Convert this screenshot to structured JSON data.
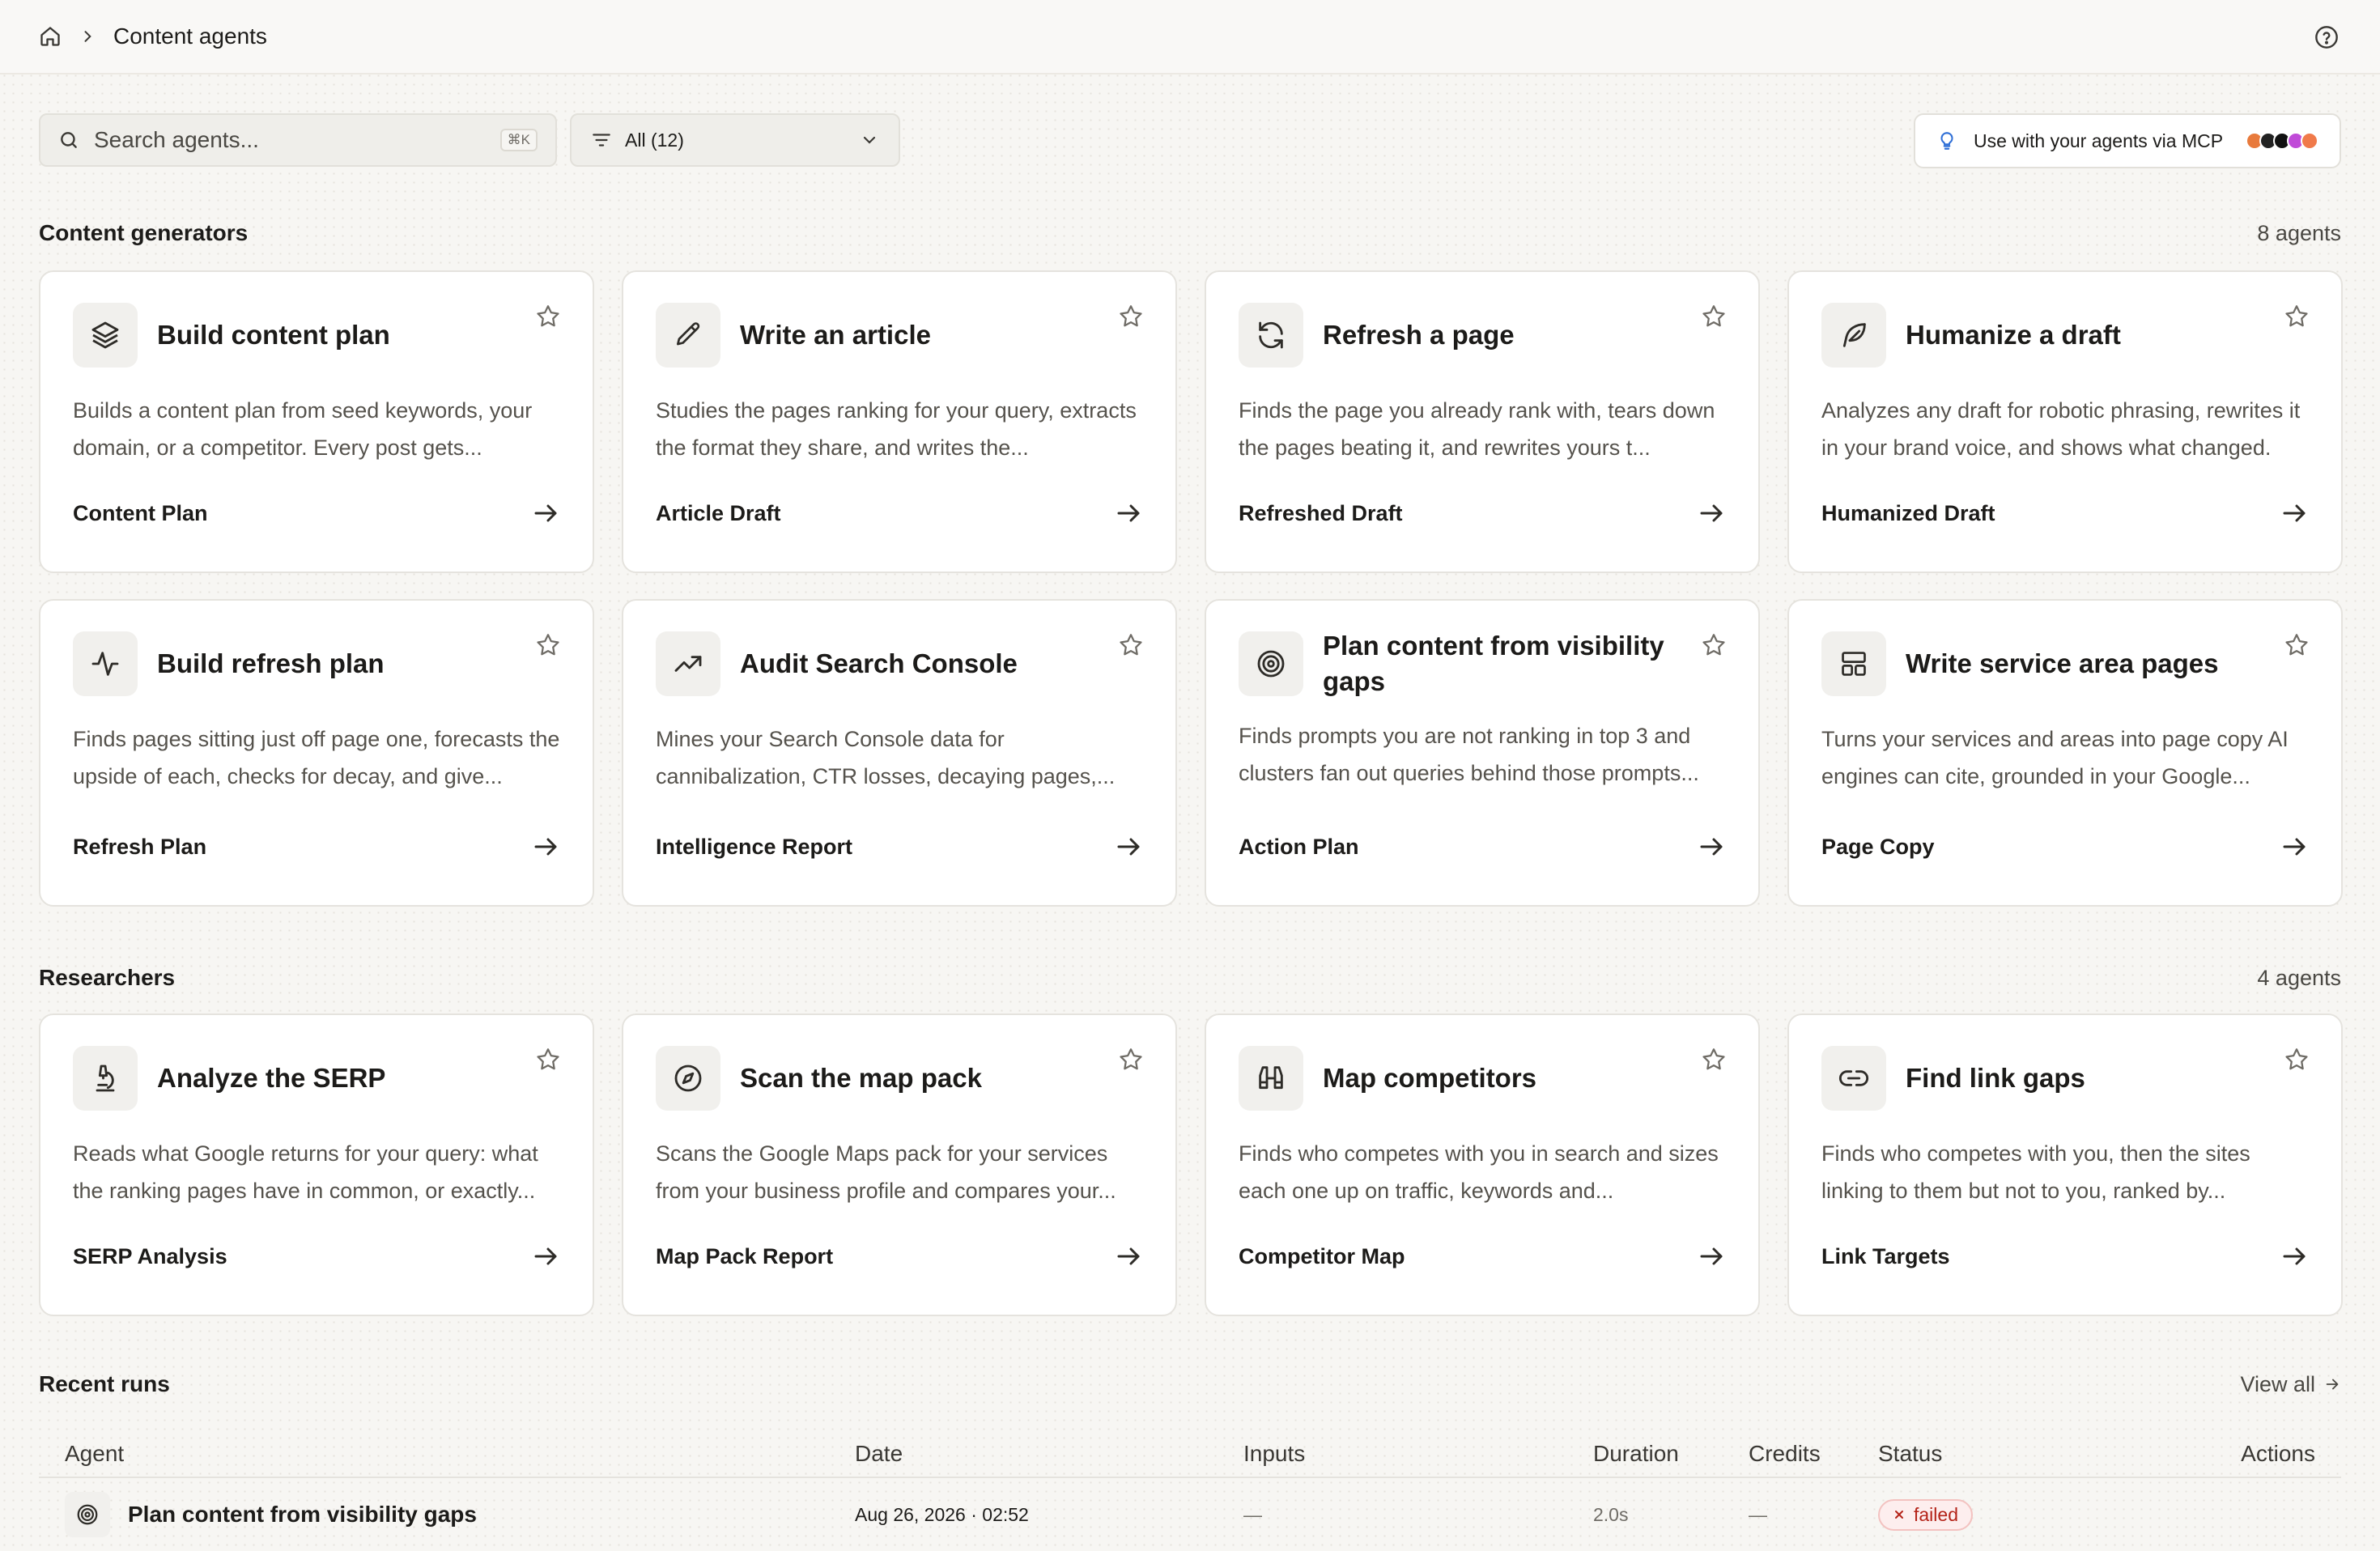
{
  "breadcrumb": {
    "current": "Content agents"
  },
  "search": {
    "placeholder": "Search agents...",
    "shortcut": "⌘K"
  },
  "filter": {
    "label": "All (12)"
  },
  "mcp": {
    "label": "Use with your agents via MCP",
    "logo_colors": [
      "#e87a3c",
      "#222222",
      "#111111",
      "#c04bd8",
      "#f07a4a"
    ]
  },
  "sections": [
    {
      "title": "Content generators",
      "count": "8 agents",
      "cards": [
        {
          "title": "Build content plan",
          "icon": "layers-icon",
          "desc": "Builds a content plan from seed keywords, your domain, or a competitor. Every post gets...",
          "output": "Content Plan"
        },
        {
          "title": "Write an article",
          "icon": "pencil-icon",
          "desc": "Studies the pages ranking for your query, extracts the format they share, and writes the...",
          "output": "Article Draft"
        },
        {
          "title": "Refresh a page",
          "icon": "refresh-icon",
          "desc": "Finds the page you already rank with, tears down the pages beating it, and rewrites yours t...",
          "output": "Refreshed Draft"
        },
        {
          "title": "Humanize a draft",
          "icon": "feather-icon",
          "desc": "Analyzes any draft for robotic phrasing, rewrites it in your brand voice, and shows what changed.",
          "output": "Humanized Draft"
        },
        {
          "title": "Build refresh plan",
          "icon": "activity-icon",
          "desc": "Finds pages sitting just off page one, forecasts the upside of each, checks for decay, and give...",
          "output": "Refresh Plan"
        },
        {
          "title": "Audit Search Console",
          "icon": "trending-up-icon",
          "desc": "Mines your Search Console data for cannibalization, CTR losses, decaying pages,...",
          "output": "Intelligence Report"
        },
        {
          "title": "Plan content from visibility gaps",
          "icon": "target-icon",
          "desc": "Finds prompts you are not ranking in top 3 and clusters fan out queries behind those prompts...",
          "output": "Action Plan"
        },
        {
          "title": "Write service area pages",
          "icon": "layout-icon",
          "desc": "Turns your services and areas into page copy AI engines can cite, grounded in your Google...",
          "output": "Page Copy"
        }
      ]
    },
    {
      "title": "Researchers",
      "count": "4 agents",
      "cards": [
        {
          "title": "Analyze the SERP",
          "icon": "microscope-icon",
          "desc": "Reads what Google returns for your query: what the ranking pages have in common, or exactly...",
          "output": "SERP Analysis"
        },
        {
          "title": "Scan the map pack",
          "icon": "compass-icon",
          "desc": "Scans the Google Maps pack for your services from your business profile and compares your...",
          "output": "Map Pack Report"
        },
        {
          "title": "Map competitors",
          "icon": "binoculars-icon",
          "desc": "Finds who competes with you in search and sizes each one up on traffic, keywords and...",
          "output": "Competitor Map"
        },
        {
          "title": "Find link gaps",
          "icon": "link-icon",
          "desc": "Finds who competes with you, then the sites linking to them but not to you, ranked by...",
          "output": "Link Targets"
        }
      ]
    }
  ],
  "recent_runs": {
    "title": "Recent runs",
    "view_all": "View all",
    "columns": [
      "Agent",
      "Date",
      "Inputs",
      "Duration",
      "Credits",
      "Status",
      "Actions"
    ],
    "rows": [
      {
        "agent": "Plan content from visibility gaps",
        "icon": "target-icon",
        "date": "Aug 26, 2026 · 02:52",
        "inputs": "—",
        "duration": "2.0s",
        "credits": "—",
        "status": "failed"
      }
    ]
  }
}
